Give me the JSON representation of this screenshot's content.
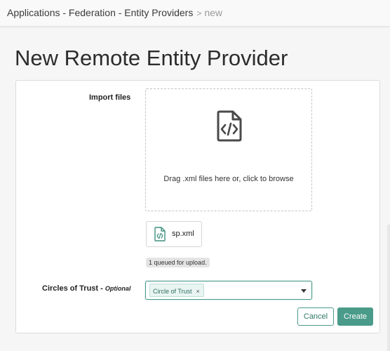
{
  "breadcrumb": {
    "path": "Applications - Federation - Entity Providers",
    "separator": ">",
    "current": "new"
  },
  "page": {
    "title": "New Remote Entity Provider"
  },
  "import_files": {
    "label": "Import files",
    "dropzone_text": "Drag .xml files here or, click to browse",
    "icon": "file-code-icon",
    "files": [
      {
        "name": "sp.xml",
        "icon": "file-code-icon"
      }
    ],
    "queue_status": "1 queued for upload."
  },
  "circles_of_trust": {
    "label": "Circles of Trust -",
    "optional_label": "Optional",
    "selected_tags": [
      "Circle of Trust"
    ],
    "tag_remove_glyph": "×"
  },
  "actions": {
    "cancel_label": "Cancel",
    "create_label": "Create"
  },
  "colors": {
    "accent": "#4a9b8a",
    "tag_bg": "#e9f5f2"
  }
}
